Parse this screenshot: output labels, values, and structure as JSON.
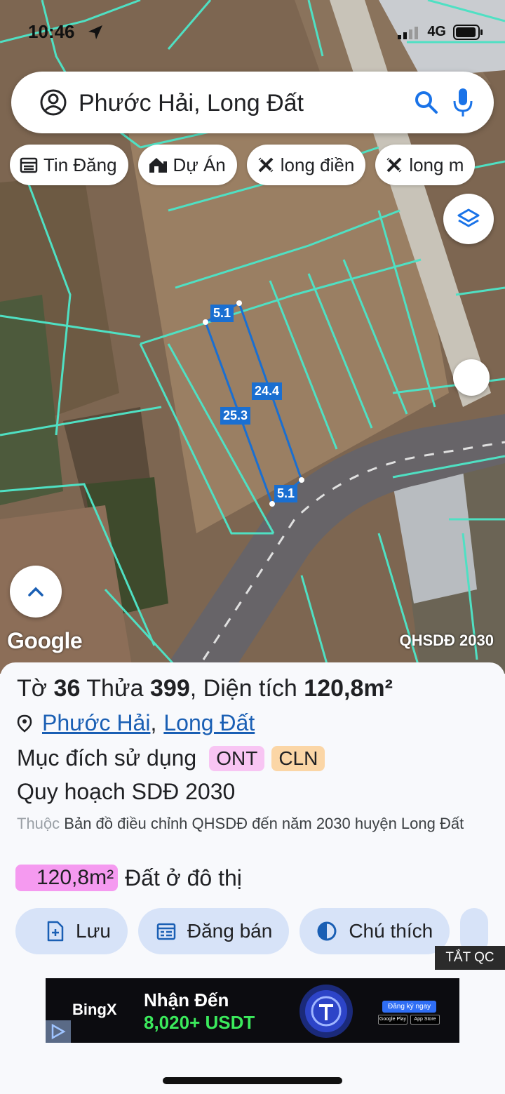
{
  "status_bar": {
    "time": "10:46",
    "network": "4G"
  },
  "search": {
    "query": "Phước Hải, Long Đất"
  },
  "filters": [
    {
      "label": "Tin Đăng",
      "icon": "calendar-icon"
    },
    {
      "label": "Dự Án",
      "icon": "building-icon"
    },
    {
      "label": "long điền",
      "icon": "close-pattern-icon"
    },
    {
      "label": "long m",
      "icon": "close-pattern-icon"
    }
  ],
  "map": {
    "attribution": "Google",
    "layer_name": "QHSDĐ 2030",
    "parcel_dimensions": {
      "top": "5.1",
      "right": "24.4",
      "left": "25.3",
      "bottom": "5.1"
    }
  },
  "parcel": {
    "title_prefix": "Tờ",
    "sheet": "36",
    "plot_label": "Thửa",
    "plot": "399",
    "area_label": "Diện tích",
    "area": "120,8m²",
    "location": {
      "ward": "Phước Hải",
      "separator": ",",
      "district": "Long Đất"
    },
    "purpose_label": "Mục đích sử dụng",
    "purpose_tags": [
      "ONT",
      "CLN"
    ],
    "plan_title": "Quy hoạch SDĐ 2030",
    "plan_prefix": "Thuộc",
    "plan_desc": "Bản đồ điều chỉnh QHSDĐ đến năm 2030 huyện Long Đất",
    "zoning_area": "120,8m²",
    "zoning_label": "Đất ở đô thị"
  },
  "actions": [
    {
      "label": "Lưu",
      "icon": "add-file-icon"
    },
    {
      "label": "Đăng bán",
      "icon": "calendar-icon"
    },
    {
      "label": "Chú thích",
      "icon": "contrast-icon"
    }
  ],
  "ad": {
    "close_label": "TẮT QC",
    "brand": "BingX",
    "headline": "Nhận Đến",
    "amount": "8,020+ USDT",
    "cta": "Đăng ký ngay",
    "store1": "Google Play",
    "store2": "App Store"
  },
  "colors": {
    "parcel_boundary": "#4fe0c3",
    "measure_line": "#1a6fd1",
    "tag_ont": "#f8c5f3",
    "tag_cln": "#fbd6a6",
    "zoning_badge": "#f59af0",
    "action_bg": "#d7e3f8",
    "link": "#1a5fb4"
  }
}
